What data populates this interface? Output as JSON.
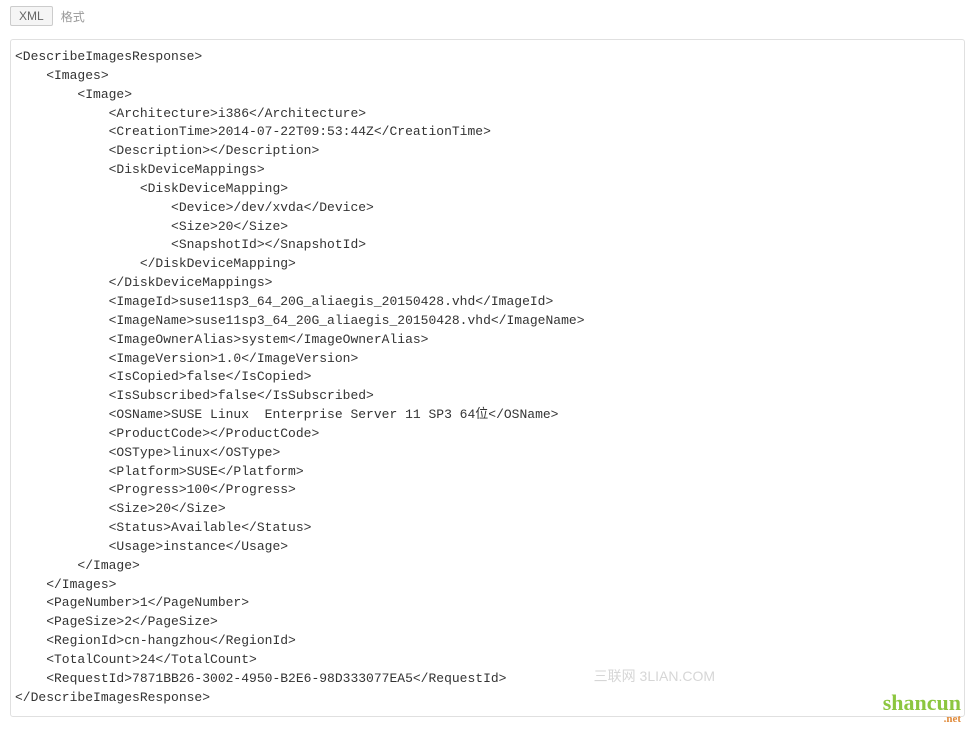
{
  "toolbar": {
    "xml_label": "XML",
    "format_label": "格式"
  },
  "xml": {
    "root_open": "<DescribeImagesResponse>",
    "images_open": "<Images>",
    "image_open": "<Image>",
    "fields": {
      "architecture": {
        "tag": "Architecture",
        "value": "i386"
      },
      "creation_time": {
        "tag": "CreationTime",
        "value": "2014-07-22T09:53:44Z"
      },
      "description": {
        "tag": "Description",
        "value": ""
      },
      "ddm_open": "<DiskDeviceMappings>",
      "ddm_item_open": "<DiskDeviceMapping>",
      "device": {
        "tag": "Device",
        "value": "/dev/xvda"
      },
      "ddm_size": {
        "tag": "Size",
        "value": "20"
      },
      "snapshot": {
        "tag": "SnapshotId",
        "value": ""
      },
      "ddm_item_close": "</DiskDeviceMapping>",
      "ddm_close": "</DiskDeviceMappings>",
      "image_id": {
        "tag": "ImageId",
        "value": "suse11sp3_64_20G_aliaegis_20150428.vhd"
      },
      "image_name": {
        "tag": "ImageName",
        "value": "suse11sp3_64_20G_aliaegis_20150428.vhd"
      },
      "owner_alias": {
        "tag": "ImageOwnerAlias",
        "value": "system"
      },
      "image_version": {
        "tag": "ImageVersion",
        "value": "1.0"
      },
      "is_copied": {
        "tag": "IsCopied",
        "value": "false"
      },
      "is_subscribed": {
        "tag": "IsSubscribed",
        "value": "false"
      },
      "os_name": {
        "tag": "OSName",
        "value": "SUSE Linux  Enterprise Server 11 SP3 64位"
      },
      "product_code": {
        "tag": "ProductCode",
        "value": ""
      },
      "os_type": {
        "tag": "OSType",
        "value": "linux"
      },
      "platform": {
        "tag": "Platform",
        "value": "SUSE"
      },
      "progress": {
        "tag": "Progress",
        "value": "100"
      },
      "size": {
        "tag": "Size",
        "value": "20"
      },
      "status": {
        "tag": "Status",
        "value": "Available"
      },
      "usage": {
        "tag": "Usage",
        "value": "instance"
      }
    },
    "image_close": "</Image>",
    "images_close": "</Images>",
    "page_number": {
      "tag": "PageNumber",
      "value": "1"
    },
    "page_size": {
      "tag": "PageSize",
      "value": "2"
    },
    "region_id": {
      "tag": "RegionId",
      "value": "cn-hangzhou"
    },
    "total_count": {
      "tag": "TotalCount",
      "value": "24"
    },
    "request_id": {
      "tag": "RequestId",
      "value": "7871BB26-3002-4950-B2E6-98D333077EA5"
    },
    "root_close": "</DescribeImagesResponse>"
  },
  "watermarks": {
    "left": "三联网 3LIAN.COM",
    "right_main": "shancun",
    "right_sub": ".net"
  }
}
